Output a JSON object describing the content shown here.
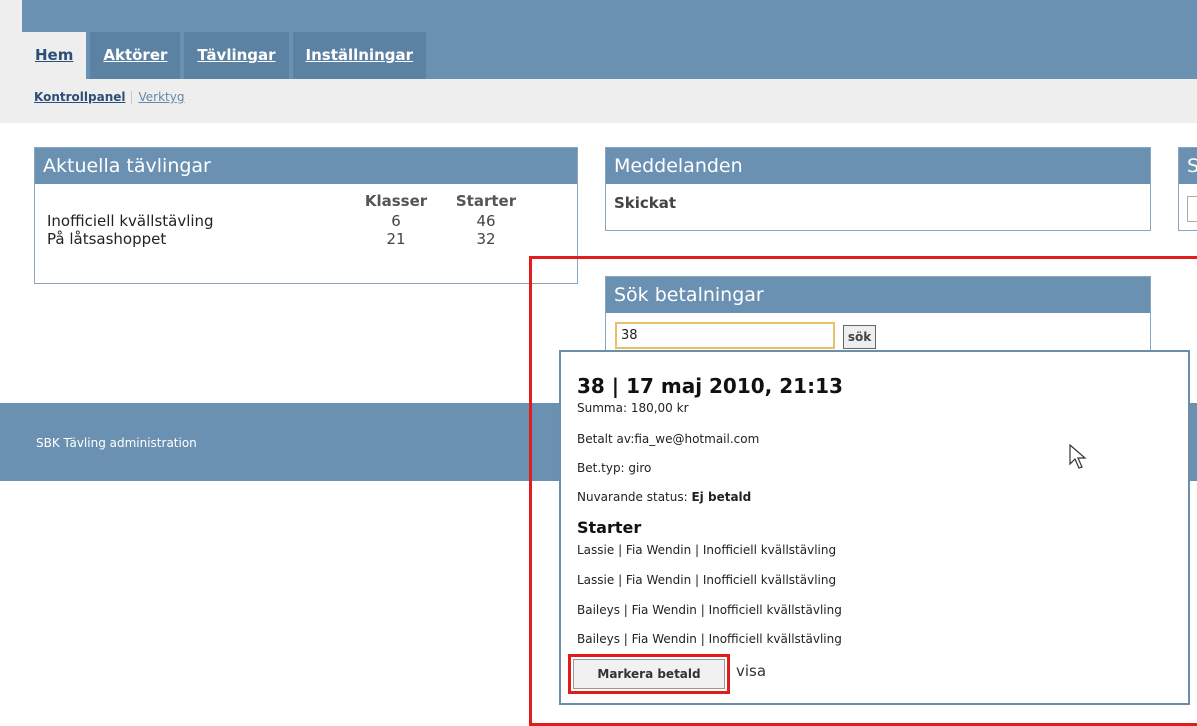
{
  "nav": {
    "tabs": [
      {
        "label": "Hem",
        "active": true
      },
      {
        "label": "Aktörer"
      },
      {
        "label": "Tävlingar"
      },
      {
        "label": "Inställningar"
      }
    ],
    "subnav": {
      "active": "Kontrollpanel",
      "link": "Verktyg"
    }
  },
  "panels": {
    "current": {
      "title": "Aktuella tävlingar",
      "col_klasser": "Klasser",
      "col_starter": "Starter",
      "rows": [
        {
          "name": "Inofficiell kvällstävling",
          "klasser": "6",
          "starter": "46"
        },
        {
          "name": "På låtsashoppet",
          "klasser": "21",
          "starter": "32"
        }
      ]
    },
    "messages": {
      "title": "Meddelanden",
      "item": "Skickat"
    },
    "third": {
      "title": "S"
    },
    "search": {
      "title": "Sök betalningar",
      "query": "38",
      "button": "sök"
    }
  },
  "popup": {
    "title": "38 | 17 maj 2010, 21:13",
    "summa": "Summa: 180,00 kr",
    "betalt": "Betalt av:fia_we@hotmail.com",
    "bettyp": "Bet.typ: giro",
    "status_label": "Nuvarande status: ",
    "status_value": "Ej betald",
    "starter_heading": "Starter",
    "starters": [
      "Lassie | Fia Wendin | Inofficiell kvällstävling",
      "Lassie | Fia Wendin | Inofficiell kvällstävling",
      "Baileys | Fia Wendin | Inofficiell kvällstävling",
      "Baileys | Fia Wendin | Inofficiell kvällstävling"
    ],
    "mark_button": "Markera betald",
    "visa": "visa"
  },
  "footer": {
    "text": "SBK Tävling administration"
  },
  "colors": {
    "header_blue": "#6b91b2",
    "highlight_red": "#e21b1b",
    "input_border": "#e8c06a"
  },
  "icons": {
    "cursor": "mouse-pointer-icon"
  }
}
